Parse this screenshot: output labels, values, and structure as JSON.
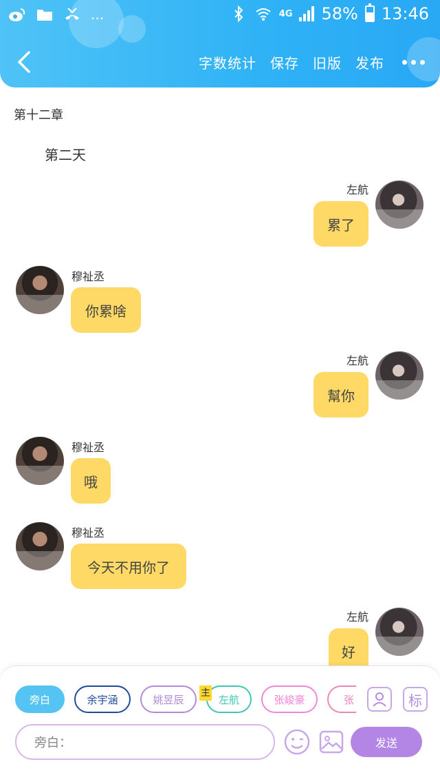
{
  "status_bar": {
    "left_icons": [
      "weibo-icon",
      "folder-icon",
      "missed-call-icon"
    ],
    "more": "...",
    "network": "4G",
    "battery": "58%",
    "battery_level": 0.58,
    "time": "13:46"
  },
  "nav": {
    "actions": [
      "字数统计",
      "保存",
      "旧版",
      "发布"
    ]
  },
  "content": {
    "chapter_title": "第十二章",
    "narration": "第二天",
    "messages": [
      {
        "side": "right",
        "name": "左航",
        "text": "累了"
      },
      {
        "side": "left",
        "name": "穆祉丞",
        "text": "你累啥"
      },
      {
        "side": "right",
        "name": "左航",
        "text": "幫你"
      },
      {
        "side": "left",
        "name": "穆祉丞",
        "text": "哦"
      },
      {
        "side": "left",
        "name": "穆祉丞",
        "text": "今天不用你了"
      },
      {
        "side": "right",
        "name": "左航",
        "text": "好"
      }
    ]
  },
  "input_panel": {
    "roles": [
      {
        "label": "旁白",
        "color": "#56c4f2",
        "active": true
      },
      {
        "label": "余宇涵",
        "color": "#1e4a9c",
        "active": false
      },
      {
        "label": "姚昱辰",
        "color": "#b28bd8",
        "active": false
      },
      {
        "label": "左航",
        "color": "#3cc7b4",
        "active": false
      },
      {
        "label": "张峻豪",
        "color": "#ef86d8",
        "active": false
      },
      {
        "label": "张",
        "color": "#ef86b8",
        "active": false
      }
    ],
    "host_tag": "主",
    "mark_button": "标",
    "input_placeholder": "旁白：",
    "send_label": "发送"
  }
}
